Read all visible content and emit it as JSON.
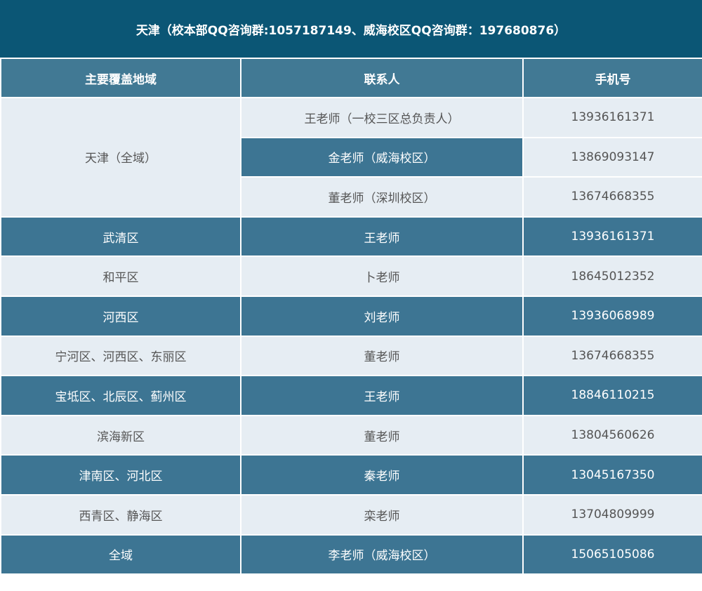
{
  "title": "天津（校本部QQ咨询群:1057187149、威海校区QQ咨询群：197680876）",
  "headers": [
    "主要覆盖地域",
    "联系人",
    "手机号"
  ],
  "tianjin": {
    "region": "天津（全域）",
    "contacts": [
      {
        "name": "王老师（一校三区总负责人）",
        "phone": "13936161371"
      },
      {
        "name": "金老师（威海校区）",
        "phone": "13869093147"
      },
      {
        "name": "董老师（深圳校区）",
        "phone": "13674668355"
      }
    ]
  },
  "rows": [
    {
      "region": "武清区",
      "name": "王老师",
      "phone": "13936161371"
    },
    {
      "region": "和平区",
      "name": "卜老师",
      "phone": "18645012352"
    },
    {
      "region": "河西区",
      "name": "刘老师",
      "phone": "13936068989"
    },
    {
      "region": "宁河区、河西区、东丽区",
      "name": "董老师",
      "phone": "13674668355"
    },
    {
      "region": "宝坻区、北辰区、蓟州区",
      "name": "王老师",
      "phone": "18846110215"
    },
    {
      "region": "滨海新区",
      "name": "董老师",
      "phone": "13804560626"
    },
    {
      "region": "津南区、河北区",
      "name": "秦老师",
      "phone": "13045167350"
    },
    {
      "region": "西青区、静海区",
      "name": "栾老师",
      "phone": "13704809999"
    },
    {
      "region": "全域",
      "name": "李老师（威海校区）",
      "phone": "15065105086"
    }
  ]
}
